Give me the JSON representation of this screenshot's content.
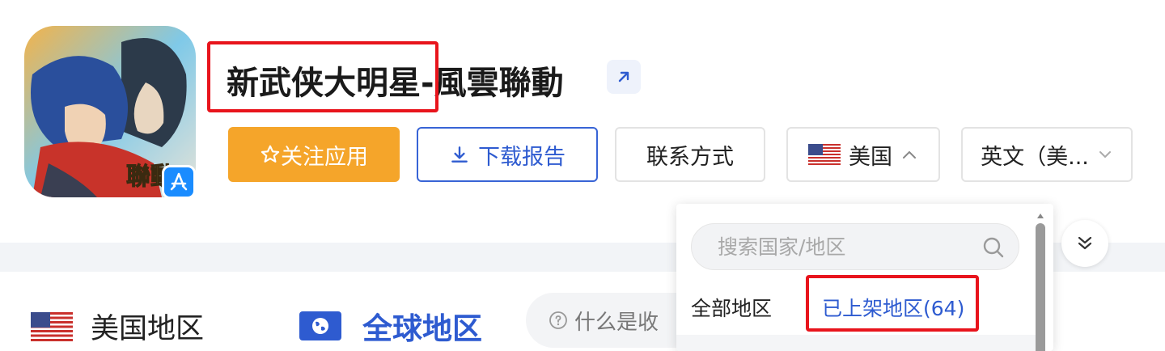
{
  "app": {
    "title": "新武侠大明星-風雲聯動",
    "icon_badge_text": "聯動",
    "store": "app-store-icon"
  },
  "actions": {
    "follow_label": "关注应用",
    "download_label": "下载报告",
    "contact_label": "联系方式",
    "country_label": "美国",
    "language_label": "英文（美..."
  },
  "regions": {
    "us_label": "美国地区",
    "global_label": "全球地区",
    "help_label": "什么是收"
  },
  "dropdown": {
    "search_placeholder": "搜索国家/地区",
    "filter_all": "全部地区",
    "filter_listed": "已上架地区(64)"
  },
  "colors": {
    "accent_orange": "#f5a52a",
    "accent_blue": "#2e5bd0",
    "highlight_red": "#e8141c"
  }
}
